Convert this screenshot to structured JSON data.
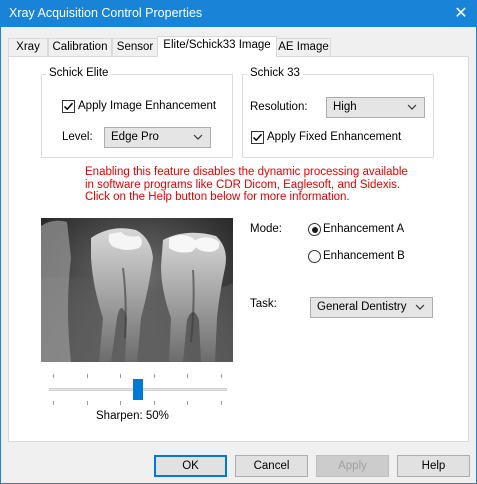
{
  "window": {
    "title": "Xray Acquisition Control Properties",
    "close_glyph": "✕"
  },
  "tabs": [
    {
      "label": "Xray"
    },
    {
      "label": "Calibration"
    },
    {
      "label": "Sensor"
    },
    {
      "label": "Elite/Schick33 Image",
      "active": true
    },
    {
      "label": "AE Image"
    }
  ],
  "schick_elite": {
    "group_label": "Schick Elite",
    "apply_enhancement_label": "Apply Image Enhancement",
    "apply_enhancement_checked": true,
    "level_label": "Level:",
    "level_value": "Edge Pro"
  },
  "schick_33": {
    "group_label": "Schick 33",
    "resolution_label": "Resolution:",
    "resolution_value": "High",
    "apply_fixed_label": "Apply Fixed Enhancement",
    "apply_fixed_checked": true
  },
  "warning": {
    "line1": "Enabling this feature disables the dynamic processing available",
    "line2": "in software programs like CDR Dicom, Eaglesoft, and Sidexis.",
    "line3": "Click on the Help button below for more information.",
    "color": "#e60000"
  },
  "mode": {
    "label": "Mode:",
    "option_a": "Enhancement A",
    "option_b": "Enhancement B",
    "selected": "Enhancement A"
  },
  "task": {
    "label": "Task:",
    "value": "General Dentistry"
  },
  "sharpen": {
    "label": "Sharpen: 50%",
    "value_percent": 50
  },
  "buttons": {
    "ok": "OK",
    "cancel": "Cancel",
    "apply": "Apply",
    "help": "Help"
  },
  "colors": {
    "accent": "#0078d7",
    "titlebar": "#1883d7"
  }
}
